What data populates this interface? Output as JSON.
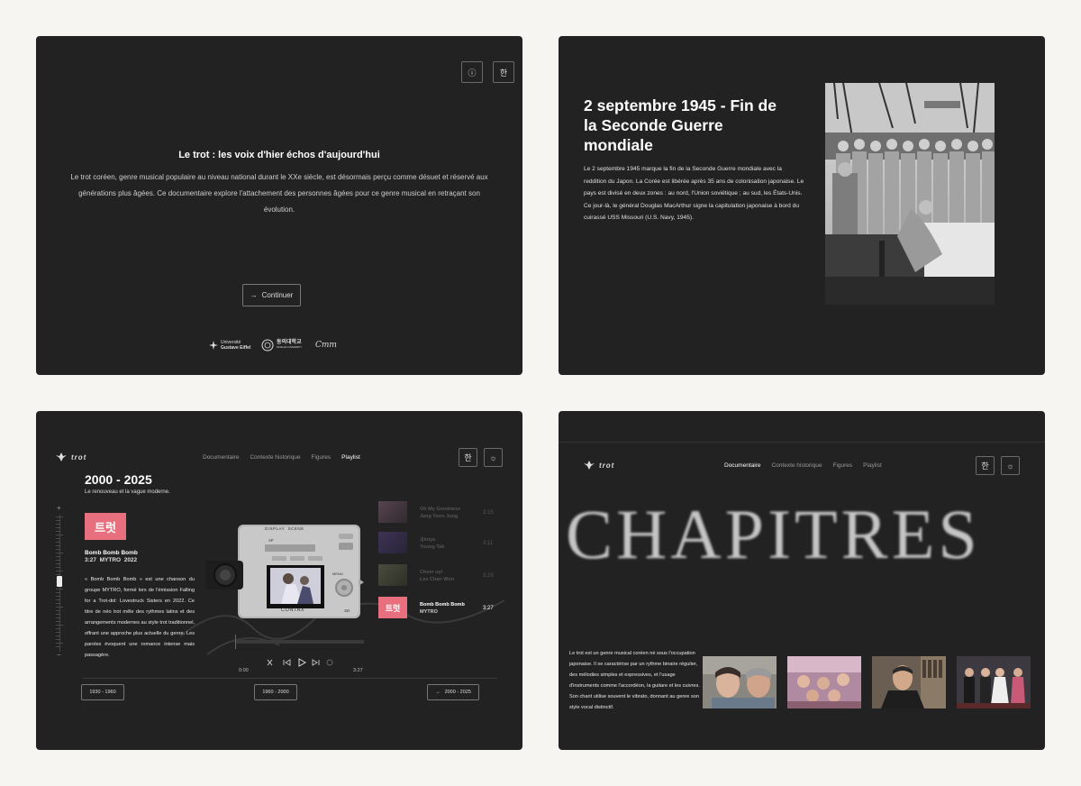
{
  "intro": {
    "info_icon": "ⓘ",
    "lang_label": "한",
    "title": "Le trot : les voix d'hier échos d'aujourd'hui",
    "description": "Le trot coréen, genre musical populaire au niveau national durant le XXe siècle, est désormais perçu comme désuet et réservé aux générations plus âgées. Ce documentaire explore l'attachement des personnes âgées pour ce genre musical en retraçant son évolution.",
    "continue_label": "Continuer",
    "partner1_line1": "Université",
    "partner1_line2": "Gustave Eiffel",
    "partner2": "동의대학교",
    "partner2_sub": "DONG-EUI UNIVERSITY",
    "partner3": "Cmm"
  },
  "history": {
    "title": "2 septembre 1945 - Fin de la Seconde Guerre mondiale",
    "body": "Le 2 septembre 1945 marque la fin de la Seconde Guerre mondiale avec la reddition du Japon. La Corée est libérée après 35 ans de colonisation japonaise. Le pays est divisé en deux zones : au nord, l'Union soviétique ; au sud, les États-Unis. Ce jour-là, le général Douglas MacArthur signe la capitulation japonaise à bord du cuirassé USS Missouri (U.S. Navy, 1945)."
  },
  "nav": {
    "logo": "trot",
    "items": [
      "Documentaire",
      "Contexte historique",
      "Figures",
      "Playlist"
    ],
    "lang_label": "한",
    "sun_icon": "☼"
  },
  "playlist": {
    "era_title": "2000 - 2025",
    "era_subtitle": "Le renouveau et la vague moderne.",
    "album_art_text": "트럿",
    "song_title": "Bomb Bomb Bomb",
    "song_meta": "3:27  MYTRO  2022",
    "song_description": "« Bomb Bomb Bomb » est une chanson du groupe MYTRO, formé lors de l'émission Falling for a Trot-dol: Lovestruck Sisters en 2022. Ce titre de néo trot mêle des rythmes latins et des arrangements modernes au style trot traditionnel, offrant une approche plus actuelle du genre. Les paroles évoquent une romance intense mais passagère.",
    "scale_plus": "+",
    "scale_minus": "−",
    "camera_top_label": "DISPLAY  SCENE",
    "camera_brand": "CONTAX",
    "camera_menu": "MENU",
    "camera_sd": "SD",
    "camera_af": "AF",
    "time_start": "0:00",
    "time_end": "3:27",
    "tracks": [
      {
        "title": "Oh My Goodness",
        "artist": "Jang Yoon Jung",
        "duration": "3:15",
        "active": false
      },
      {
        "title": "Jjiniya",
        "artist": "Young Tak",
        "duration": "3:11",
        "active": false
      },
      {
        "title": "Cheer up!",
        "artist": "Lee Chan Won",
        "duration": "3:29",
        "active": false
      },
      {
        "title": "Bomb Bomb Bomb",
        "artist": "MYTRO",
        "duration": "3:27",
        "active": true
      }
    ],
    "eras": [
      "1930 - 1960",
      "1960 - 2000",
      "2000 - 2025"
    ],
    "selected_era_arrow": "→"
  },
  "chapters": {
    "heading": "CHAPITRES",
    "intro": "Le trot est un genre musical coréen né sous l'occupation japonaise. Il se caractérise par un rythme binaire régulier, des mélodies simples et expressives, et l'usage d'instruments comme l'accordéon, la guitare et les cuivres. Son chant utilise souvent le vibrato, donnant au genre son style vocal distinctif."
  },
  "colors": {
    "panel_bg": "#222222",
    "page_bg": "#f6f5f1",
    "album_pink": "#e8707e",
    "text_primary": "#ffffff",
    "text_muted": "#9a9a9a"
  }
}
